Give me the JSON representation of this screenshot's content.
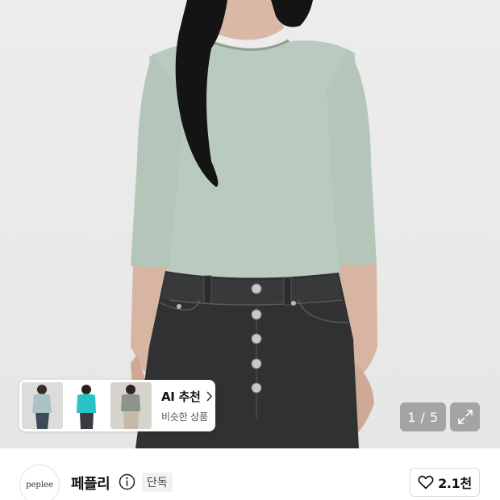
{
  "ai_recommend": {
    "title": "AI 추천",
    "subtitle": "비슷한 상품",
    "thumbnails": [
      {
        "icon": "model-sage-top"
      },
      {
        "icon": "model-teal-top"
      },
      {
        "icon": "model-khaki-top"
      }
    ]
  },
  "gallery": {
    "counter": "1 / 5",
    "current": 1,
    "total": 5
  },
  "seller": {
    "logo_text": "peplee",
    "name": "페플리",
    "badge": "단독",
    "likes": "2.1천"
  },
  "colors": {
    "top_sage": "#b9cbbf",
    "denim": "#2f3133",
    "teal_thumb": "#27c3c7"
  }
}
